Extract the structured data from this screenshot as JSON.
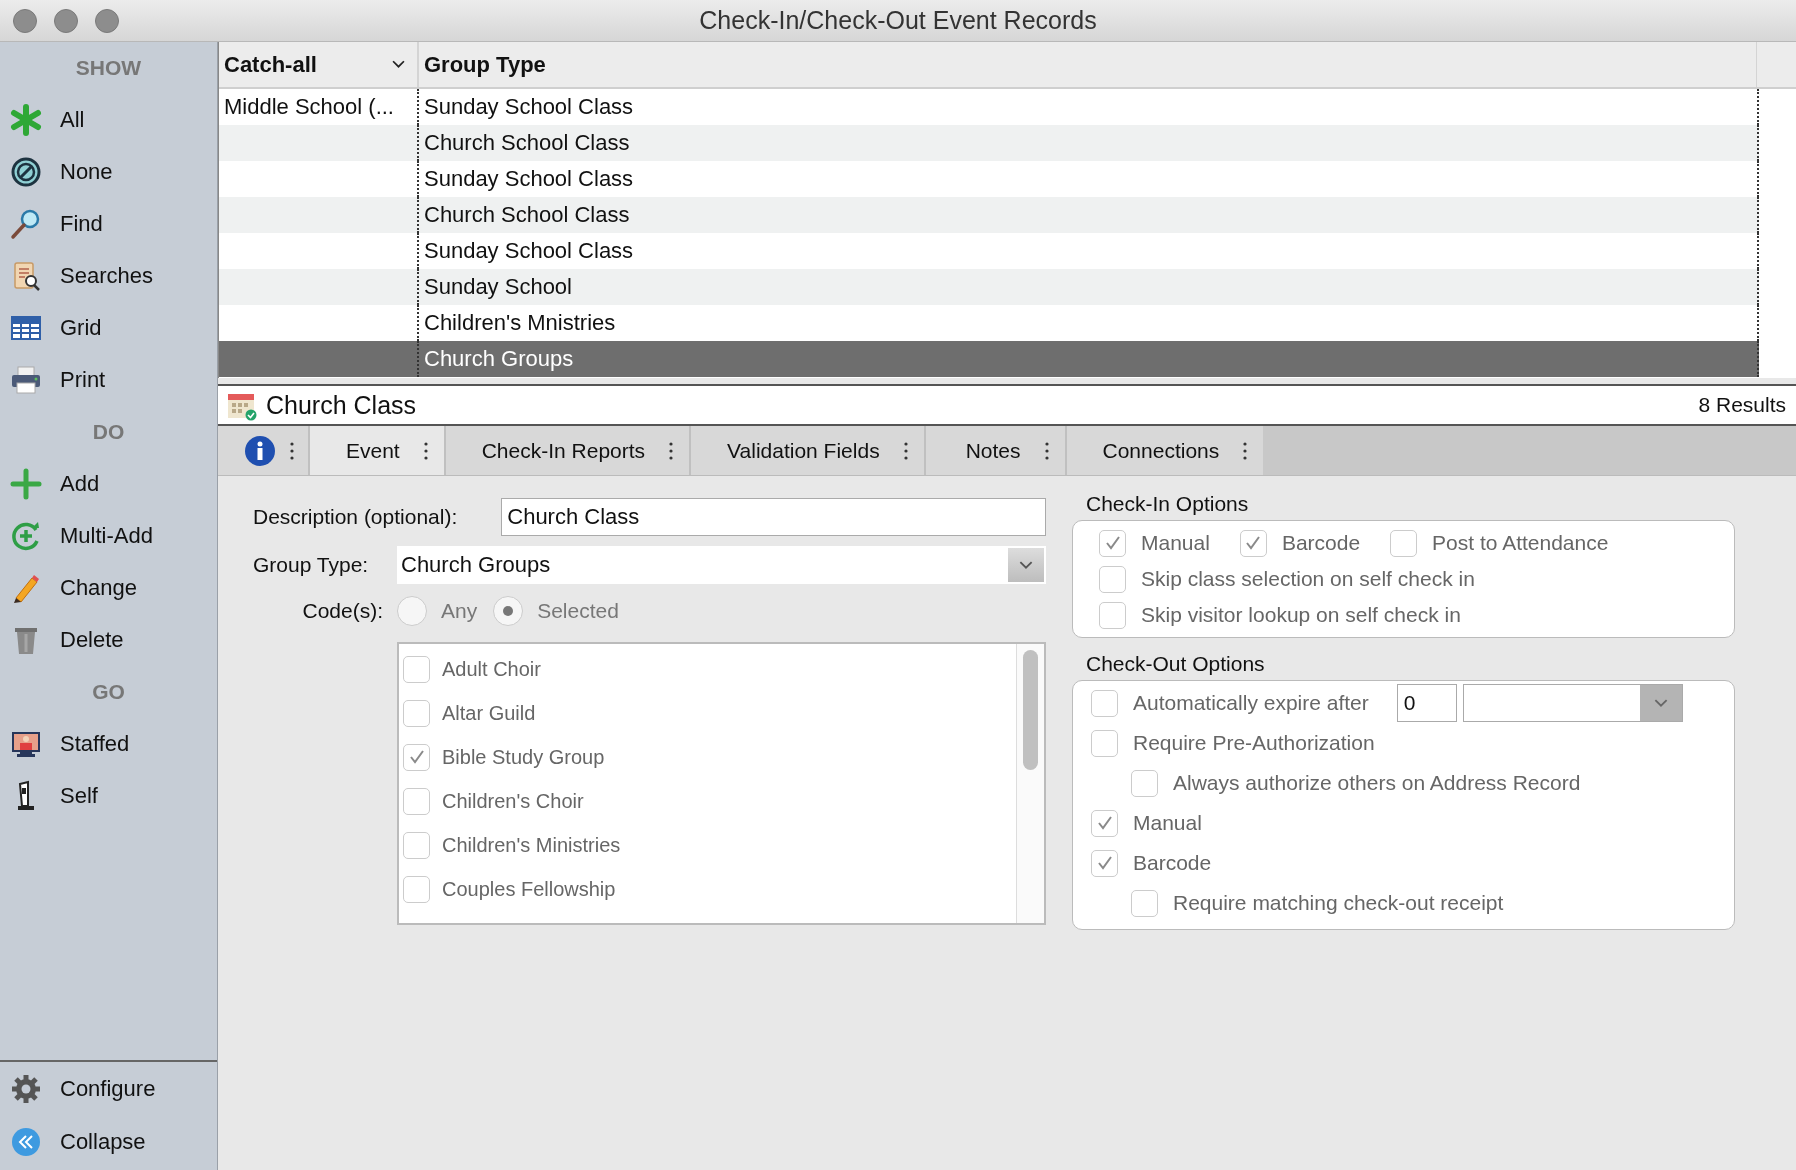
{
  "window": {
    "title": "Check-In/Check-Out Event Records"
  },
  "sidebar": {
    "sections": [
      {
        "heading": "SHOW",
        "items": [
          {
            "label": "All"
          },
          {
            "label": "None"
          },
          {
            "label": "Find"
          },
          {
            "label": "Searches"
          },
          {
            "label": "Grid"
          },
          {
            "label": "Print"
          }
        ]
      },
      {
        "heading": "DO",
        "items": [
          {
            "label": "Add"
          },
          {
            "label": "Multi-Add"
          },
          {
            "label": "Change"
          },
          {
            "label": "Delete"
          }
        ]
      },
      {
        "heading": "GO",
        "items": [
          {
            "label": "Staffed"
          },
          {
            "label": "Self"
          }
        ]
      }
    ],
    "footer": [
      {
        "label": "Configure"
      },
      {
        "label": "Collapse"
      }
    ]
  },
  "table": {
    "columns": [
      {
        "label": "Catch-all"
      },
      {
        "label": "Group Type"
      }
    ],
    "rows": [
      {
        "catch_all": "Middle School (...",
        "group_type": "Sunday School Class",
        "selected": false
      },
      {
        "group_type": "Church School Class",
        "selected": false
      },
      {
        "group_type": "Sunday School Class",
        "selected": false
      },
      {
        "group_type": "Church School Class",
        "selected": false
      },
      {
        "group_type": "Sunday School Class",
        "selected": false
      },
      {
        "group_type": "Sunday School",
        "selected": false
      },
      {
        "group_type": "Children's Mnistries",
        "selected": false
      },
      {
        "group_type": "Church Groups",
        "selected": true
      }
    ]
  },
  "record": {
    "title": "Church Class",
    "results": "8 Results"
  },
  "tabs": [
    {
      "label": "Event",
      "selected": true
    },
    {
      "label": "Check-In Reports",
      "selected": false
    },
    {
      "label": "Validation Fields",
      "selected": false
    },
    {
      "label": "Notes",
      "selected": false
    },
    {
      "label": "Connections",
      "selected": false
    }
  ],
  "form": {
    "description": {
      "label": "Description (optional):",
      "value": "Church Class"
    },
    "group_type": {
      "label": "Group Type:",
      "value": "Church Groups"
    },
    "codes": {
      "label": "Code(s):",
      "options": [
        {
          "label": "Any",
          "selected": false
        },
        {
          "label": "Selected",
          "selected": true
        }
      ],
      "list": [
        {
          "label": "Adult Choir",
          "checked": false
        },
        {
          "label": "Altar Guild",
          "checked": false
        },
        {
          "label": "Bible Study Group",
          "checked": true
        },
        {
          "label": "Children's Choir",
          "checked": false
        },
        {
          "label": "Children's Ministries",
          "checked": false
        },
        {
          "label": "Couples Fellowship",
          "checked": false
        }
      ]
    }
  },
  "checkin_options": {
    "title": "Check-In Options",
    "rows": [
      {
        "items": [
          {
            "label": "Manual",
            "checked": true
          },
          {
            "label": "Barcode",
            "checked": true
          },
          {
            "label": "Post to Attendance",
            "checked": false
          }
        ]
      },
      {
        "items": [
          {
            "label": "Skip class selection on self check in",
            "checked": false
          }
        ]
      },
      {
        "items": [
          {
            "label": "Skip visitor lookup on self check in",
            "checked": false
          }
        ]
      }
    ]
  },
  "checkout_options": {
    "title": "Check-Out Options",
    "items": [
      {
        "kind": "expire",
        "label": "Automatically expire after",
        "checked": false,
        "value": "0"
      },
      {
        "kind": "check",
        "label": "Require Pre-Authorization",
        "checked": false,
        "children": [
          {
            "label": "Always authorize others on Address Record",
            "checked": false
          }
        ]
      },
      {
        "kind": "check",
        "label": "Manual",
        "checked": true
      },
      {
        "kind": "check",
        "label": "Barcode",
        "checked": true,
        "children": [
          {
            "label": "Require matching check-out receipt",
            "checked": false
          }
        ]
      }
    ]
  }
}
